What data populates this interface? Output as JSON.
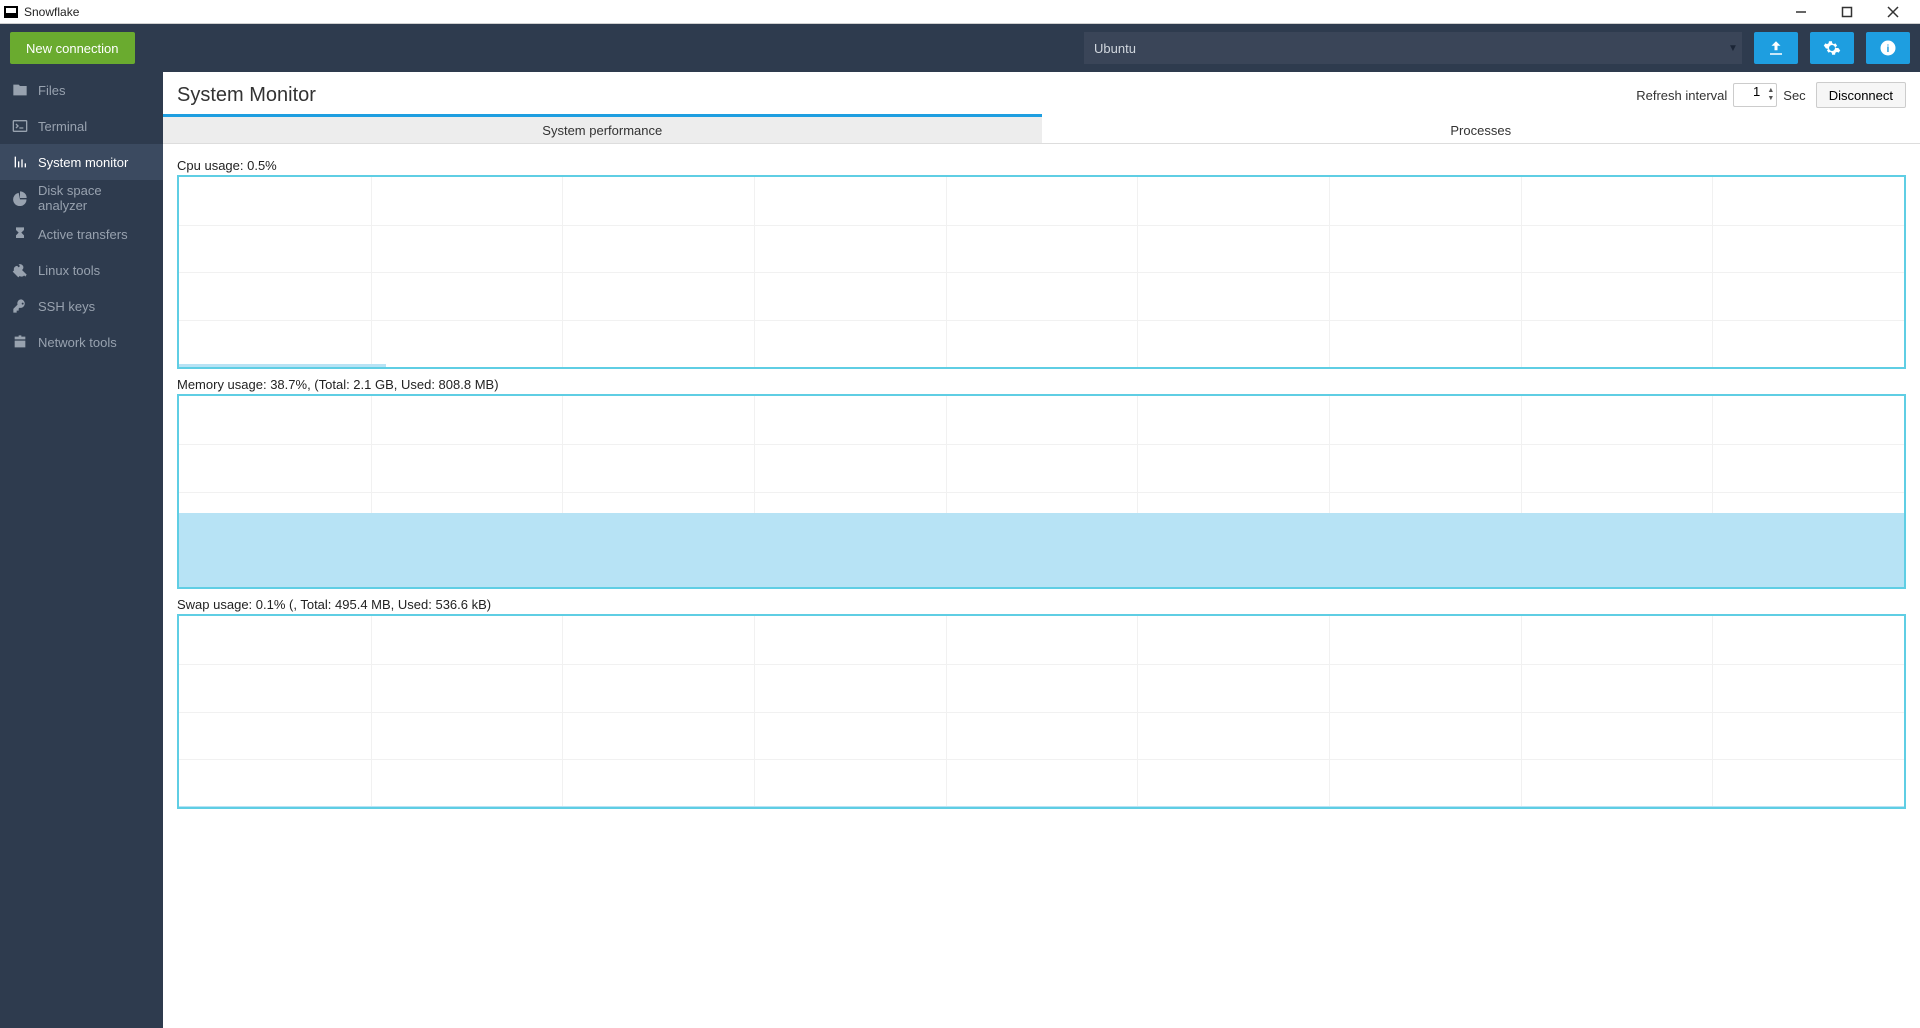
{
  "window": {
    "title": "Snowflake"
  },
  "toolbar": {
    "new_connection": "New connection",
    "connection_value": "Ubuntu"
  },
  "sidebar": {
    "items": [
      {
        "id": "files",
        "label": "Files"
      },
      {
        "id": "terminal",
        "label": "Terminal"
      },
      {
        "id": "system-monitor",
        "label": "System monitor",
        "active": true
      },
      {
        "id": "disk-space",
        "label": "Disk space analyzer"
      },
      {
        "id": "active-transfers",
        "label": "Active transfers"
      },
      {
        "id": "linux-tools",
        "label": "Linux tools"
      },
      {
        "id": "ssh-keys",
        "label": "SSH keys"
      },
      {
        "id": "network-tools",
        "label": "Network tools"
      }
    ]
  },
  "page": {
    "title": "System Monitor",
    "refresh_label": "Refresh interval",
    "refresh_value": "1",
    "refresh_unit": "Sec",
    "disconnect_label": "Disconnect"
  },
  "tabs": [
    {
      "id": "perf",
      "label": "System performance",
      "active": true
    },
    {
      "id": "proc",
      "label": "Processes"
    }
  ],
  "labels": {
    "cpu": "Cpu usage: 0.5%",
    "mem": "Memory usage: 38.7%, (Total: 2.1 GB, Used: 808.8 MB)",
    "swap": "Swap usage: 0.1%  (, Total: 495.4 MB, Used: 536.6 kB)"
  },
  "chart_data": [
    {
      "type": "area",
      "title": "Cpu usage",
      "ylabel": "%",
      "ylim": [
        0,
        100
      ],
      "x": [
        0,
        1,
        2,
        3,
        4,
        5,
        6,
        7,
        8,
        9
      ],
      "values": [
        2,
        2,
        2,
        1,
        1,
        0.5,
        0.5,
        0.5,
        0.5,
        0.5
      ],
      "current": 0.5,
      "grid": {
        "h": 4,
        "v": 9
      }
    },
    {
      "type": "area",
      "title": "Memory usage",
      "ylabel": "%",
      "ylim": [
        0,
        100
      ],
      "x": [
        0,
        1,
        2,
        3,
        4,
        5,
        6,
        7,
        8,
        9
      ],
      "values": [
        38.7,
        38.7,
        38.7,
        38.7,
        38.7,
        38.7,
        38.7,
        38.7,
        38.7,
        38.7
      ],
      "current": 38.7,
      "total": "2.1 GB",
      "used": "808.8 MB",
      "grid": {
        "h": 4,
        "v": 9
      }
    },
    {
      "type": "area",
      "title": "Swap usage",
      "ylabel": "%",
      "ylim": [
        0,
        100
      ],
      "x": [
        0,
        1,
        2,
        3,
        4,
        5,
        6,
        7,
        8,
        9
      ],
      "values": [
        0.1,
        0.1,
        0.1,
        0.1,
        0.1,
        0.1,
        0.1,
        0.1,
        0.1,
        0.1
      ],
      "current": 0.1,
      "total": "495.4 MB",
      "used": "536.6 kB",
      "grid": {
        "h": 4,
        "v": 9
      }
    }
  ]
}
